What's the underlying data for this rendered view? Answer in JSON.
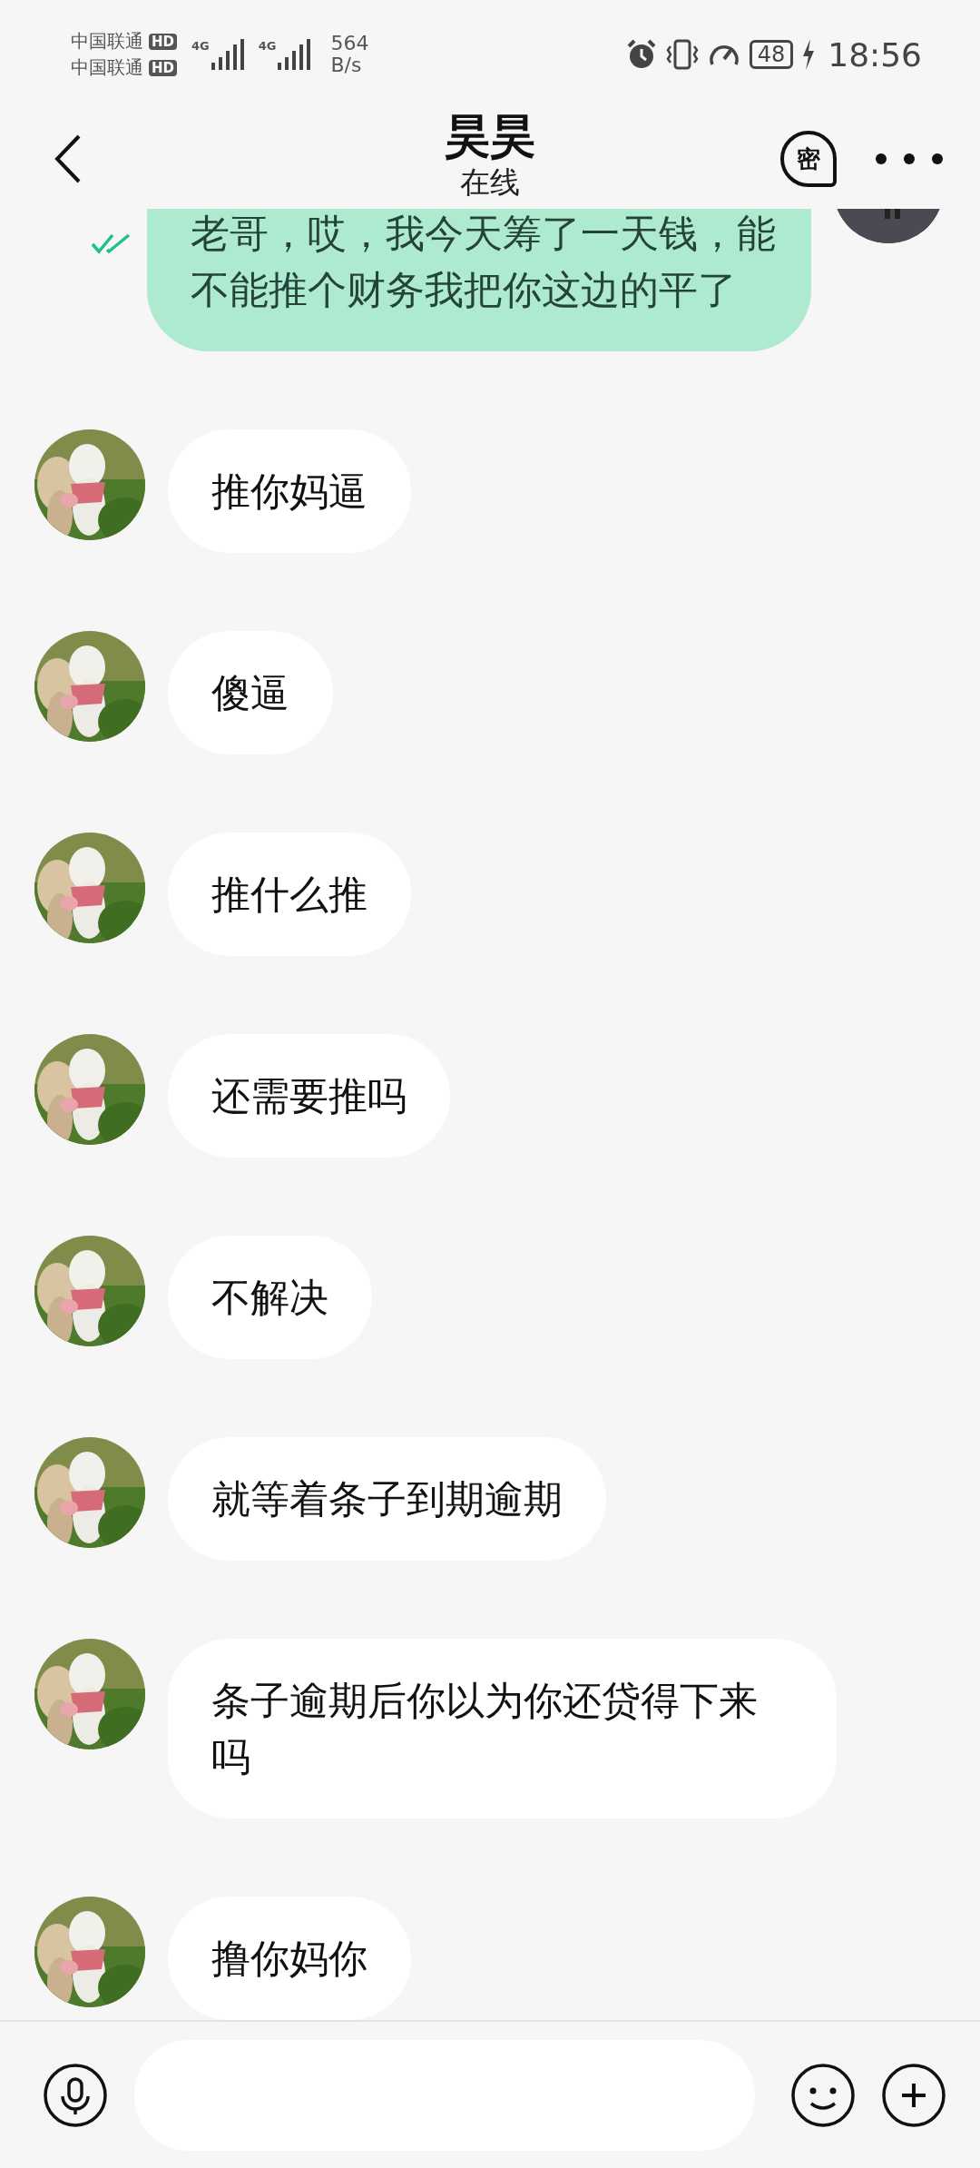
{
  "status_bar": {
    "carriers": [
      {
        "name": "中国联通",
        "badge": "HD"
      },
      {
        "name": "中国联通",
        "badge": "HD"
      }
    ],
    "networks": [
      {
        "label": "4G"
      },
      {
        "label": "4G"
      }
    ],
    "speed": {
      "value": "564",
      "unit": "B/s"
    },
    "battery": "48",
    "time": "18:56"
  },
  "header": {
    "title": "昊昊",
    "subtitle": "在线",
    "badge": "密"
  },
  "messages": [
    {
      "kind": "sent",
      "text": "老哥，哎，我今天筹了一天钱，能不能推个财务我把你这边的平了",
      "read": true
    },
    {
      "kind": "received",
      "text": "推你妈逼"
    },
    {
      "kind": "received",
      "text": "傻逼"
    },
    {
      "kind": "received",
      "text": "推什么推"
    },
    {
      "kind": "received",
      "text": "还需要推吗"
    },
    {
      "kind": "received",
      "text": "不解决"
    },
    {
      "kind": "received",
      "text": "就等着条子到期逾期"
    },
    {
      "kind": "received",
      "text": "条子逾期后你以为你还贷得下来吗"
    },
    {
      "kind": "received",
      "text": "撸你妈你"
    }
  ]
}
